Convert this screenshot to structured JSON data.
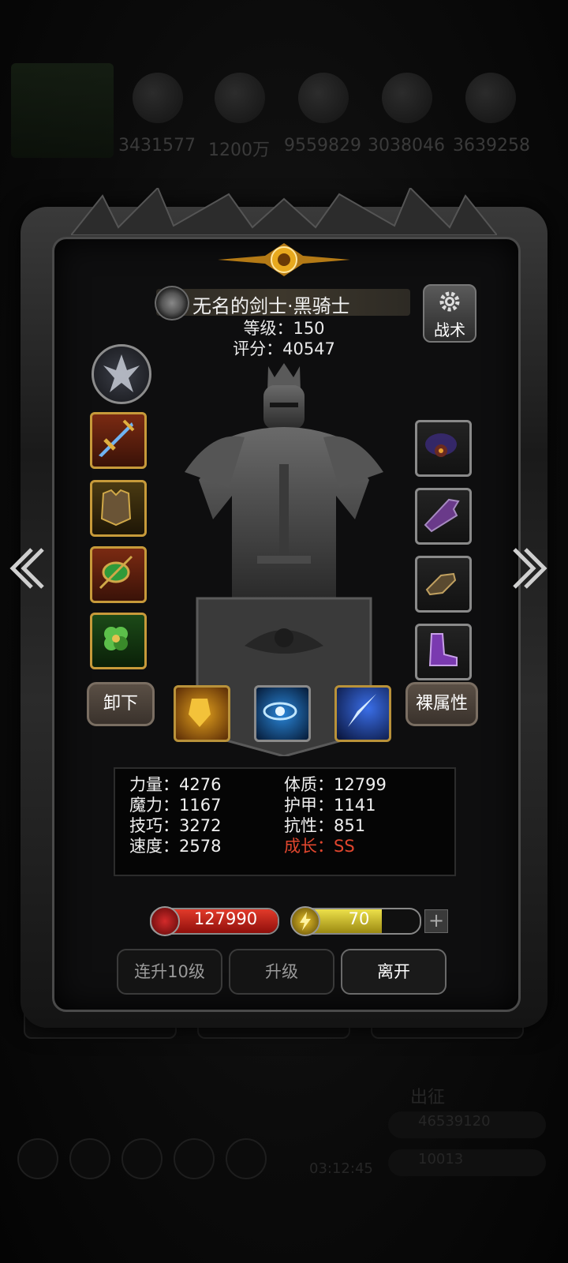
{
  "background": {
    "resources": [
      "3431577",
      "1200万",
      "9559829",
      "3038046",
      "3639258"
    ],
    "bottom_labels": [
      "出征",
      "46539120",
      "10013",
      "03:12:45"
    ]
  },
  "hero": {
    "name": "无名的剑士·黑骑士",
    "level_label": "等级",
    "level": "150",
    "score_label": "评分",
    "score": "40547"
  },
  "tactic_button": {
    "label": "战术",
    "icon": "gear-icon"
  },
  "equipment": {
    "left": [
      {
        "icon": "sword-icon",
        "frame": "orange"
      },
      {
        "icon": "armor-icon",
        "frame": "gold"
      },
      {
        "icon": "emerald-amulet-icon",
        "frame": "orange"
      },
      {
        "icon": "clover-charm-icon",
        "frame": "green"
      }
    ],
    "right": [
      {
        "icon": "dark-orb-icon"
      },
      {
        "icon": "purple-claw-icon"
      },
      {
        "icon": "bracer-icon"
      },
      {
        "icon": "purple-boots-icon"
      }
    ]
  },
  "buttons": {
    "unequip": "卸下",
    "raw_attributes": "裸属性",
    "level_up_10": "连升10级",
    "level_up": "升级",
    "leave": "离开"
  },
  "skills": [
    {
      "icon": "flame-shield-skill-icon"
    },
    {
      "icon": "eye-skill-icon"
    },
    {
      "icon": "lightning-slash-skill-icon"
    }
  ],
  "stats": {
    "left": [
      {
        "label": "力量",
        "value": "4276"
      },
      {
        "label": "魔力",
        "value": "1167"
      },
      {
        "label": "技巧",
        "value": "3272"
      },
      {
        "label": "速度",
        "value": "2578"
      }
    ],
    "right": [
      {
        "label": "体质",
        "value": "12799"
      },
      {
        "label": "护甲",
        "value": "1141"
      },
      {
        "label": "抗性",
        "value": "851"
      },
      {
        "label": "成长",
        "value": "SS"
      }
    ],
    "separator": "：",
    "highlight_color": "#e0462e"
  },
  "hp": {
    "value": "127990",
    "fill": 1.0,
    "color": "#d3291f"
  },
  "energy": {
    "value": "70",
    "fill": 0.7,
    "color": "#e6d83a"
  },
  "plus_label": "+"
}
